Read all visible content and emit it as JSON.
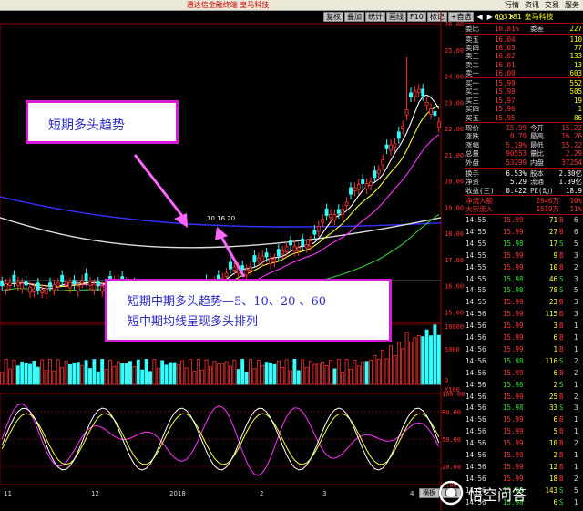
{
  "window": {
    "title": "通达信金融终端  皇马科技",
    "menu": [
      "行情",
      "资讯",
      "交易",
      "服务"
    ]
  },
  "toolbar": {
    "buttons": [
      "复权",
      "叠加",
      "统计",
      "画线",
      "F10",
      "标记",
      "+自选"
    ],
    "controls": [
      "◀",
      "▶",
      "□",
      "✕"
    ]
  },
  "chart": {
    "price_axis": [
      "26.00",
      "25.00",
      "24.00",
      "23.00",
      "22.00",
      "21.00",
      "20.00",
      "19.00",
      "18.00",
      "17.00",
      "16.00",
      "15.00"
    ],
    "volume_axis": [
      "10000",
      "5000",
      "0"
    ],
    "volume_unit": "X100",
    "indicator_axis": [
      "100.00",
      "80.00",
      "50.00",
      "20.00",
      "0.00"
    ],
    "date_ticks": [
      "11",
      "12",
      "2018",
      "2",
      "3",
      "4"
    ],
    "ma_label": "10 16.20",
    "bottom_tabs": [
      "横板",
      "日线"
    ],
    "colors": {
      "up": "#ff3333",
      "down": "#33ffff",
      "ma5": "#ffffff",
      "ma10": "#ffff33",
      "ma20": "#ff33ff",
      "ma60": "#33cc33",
      "ma120": "#3333ff",
      "ma250": "#dddddd"
    }
  },
  "annotations": {
    "short_trend": "短期多头趋势",
    "mid_trend_line1": "短期中期多头趋势—5、10、20 、60",
    "mid_trend_line2": "短中期均线呈现多头排列"
  },
  "quote": {
    "code_name": "603181 皇马科技",
    "ratio_label": "委比",
    "ratio_value": "10.81%",
    "diff_label": "委差",
    "diff_value": "227",
    "asks": [
      {
        "label": "卖五",
        "price": "16.04",
        "vol": "110"
      },
      {
        "label": "卖四",
        "price": "16.03",
        "vol": "77"
      },
      {
        "label": "卖三",
        "price": "16.02",
        "vol": "133"
      },
      {
        "label": "卖二",
        "price": "16.01",
        "vol": "13"
      },
      {
        "label": "卖一",
        "price": "16.00",
        "vol": "603"
      }
    ],
    "bids": [
      {
        "label": "买一",
        "price": "15.99",
        "vol": "552"
      },
      {
        "label": "买二",
        "price": "15.98",
        "vol": "505"
      },
      {
        "label": "买三",
        "price": "15.97",
        "vol": "19"
      },
      {
        "label": "买四",
        "price": "15.96",
        "vol": "1"
      },
      {
        "label": "买五",
        "price": "15.95",
        "vol": "86"
      }
    ],
    "stats": [
      {
        "l1": "现价",
        "v1": "15.99",
        "l2": "今开",
        "v2": "15.22"
      },
      {
        "l1": "涨跌",
        "v1": "0.79",
        "l2": "最高",
        "v2": "16.26"
      },
      {
        "l1": "涨幅",
        "v1": "5.19%",
        "l2": "最低",
        "v2": "15.22"
      },
      {
        "l1": "总量",
        "v1": "90553",
        "l2": "量比",
        "v2": "2.29"
      },
      {
        "l1": "外盘",
        "v1": "53299",
        "l2": "内盘",
        "v2": "37254"
      }
    ],
    "stats2": [
      {
        "l1": "换手",
        "v1": "6.53%",
        "l2": "股本",
        "v2": "2.80亿"
      },
      {
        "l1": "净资",
        "v1": "5.29",
        "l2": "流通",
        "v2": "1.39亿"
      },
      {
        "l1": "收益(三)",
        "v1": "0.422",
        "l2": "PE(动)",
        "v2": "18.9"
      }
    ],
    "flows": [
      {
        "label": "净流入额",
        "v1": "2646万",
        "v2": "10%"
      },
      {
        "label": "大宗流入",
        "v1": "1519万",
        "v2": "11%"
      }
    ]
  },
  "ticks": [
    {
      "t": "14:55",
      "p": "15.99",
      "v": "71",
      "bs": "B",
      "n": "6"
    },
    {
      "t": "14:55",
      "p": "15.99",
      "v": "27",
      "bs": "B",
      "n": "6"
    },
    {
      "t": "14:55",
      "p": "15.98",
      "v": "17",
      "bs": "S",
      "n": "5"
    },
    {
      "t": "14:55",
      "p": "15.99",
      "v": "9",
      "bs": "B",
      "n": "3"
    },
    {
      "t": "14:55",
      "p": "15.99",
      "v": "10",
      "bs": "B",
      "n": "2"
    },
    {
      "t": "14:55",
      "p": "15.98",
      "v": "46",
      "bs": "S",
      "n": "3"
    },
    {
      "t": "14:55",
      "p": "15.98",
      "v": "78",
      "bs": "S",
      "n": "5"
    },
    {
      "t": "14:55",
      "p": "15.99",
      "v": "23",
      "bs": "B",
      "n": "3"
    },
    {
      "t": "14:56",
      "p": "15.99",
      "v": "115",
      "bs": "B",
      "n": "3"
    },
    {
      "t": "14:56",
      "p": "15.99",
      "v": "3",
      "bs": "B",
      "n": "1"
    },
    {
      "t": "14:56",
      "p": "15.99",
      "v": "6",
      "bs": "B",
      "n": "1"
    },
    {
      "t": "14:56",
      "p": "15.99",
      "v": "1",
      "bs": "B",
      "n": "1"
    },
    {
      "t": "14:56",
      "p": "15.98",
      "v": "116",
      "bs": "S",
      "n": "2"
    },
    {
      "t": "14:56",
      "p": "15.99",
      "v": "6",
      "bs": "B",
      "n": "2"
    },
    {
      "t": "14:56",
      "p": "15.98",
      "v": "2",
      "bs": "S",
      "n": "1"
    },
    {
      "t": "14:56",
      "p": "15.99",
      "v": "25",
      "bs": "B",
      "n": "2"
    },
    {
      "t": "14:56",
      "p": "15.98",
      "v": "33",
      "bs": "S",
      "n": "3"
    },
    {
      "t": "14:56",
      "p": "15.99",
      "v": "6",
      "bs": "B",
      "n": "1"
    },
    {
      "t": "14:56",
      "p": "15.99",
      "v": "5",
      "bs": "B",
      "n": "1"
    },
    {
      "t": "14:56",
      "p": "15.99",
      "v": "10",
      "bs": "B",
      "n": "2"
    },
    {
      "t": "14:56",
      "p": "15.99",
      "v": "2",
      "bs": "B",
      "n": "1"
    },
    {
      "t": "14:56",
      "p": "15.99",
      "v": "12",
      "bs": "B",
      "n": "1"
    },
    {
      "t": "14:56",
      "p": "15.99",
      "v": "18",
      "bs": "B",
      "n": "2"
    },
    {
      "t": "14:56",
      "p": "15.98",
      "v": "143",
      "bs": "S",
      "n": "5"
    },
    {
      "t": "14:56",
      "p": "15.98",
      "v": "6",
      "bs": "S",
      "n": "1"
    }
  ],
  "watermark": {
    "text": "悟空问答"
  }
}
